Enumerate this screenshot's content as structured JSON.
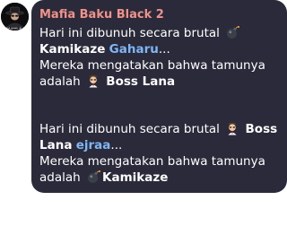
{
  "avatar": {
    "caption": "MAFIA BAKU BLACK"
  },
  "message": {
    "sender": "Mafia Baku Black 2",
    "sender_color": "#f0928a",
    "link_color": "#7fb6f5",
    "bubble_color": "#2b2a3a",
    "text_line_1": "Hari ini dibunuh secara brutal",
    "text_line_3": "Mereka mengatakan bahwa tamunya",
    "text_adalah": "adalah",
    "ellipsis": "...",
    "part1": {
      "killer_role_icon": "bomb-emoji",
      "killer_role": "Kamikaze",
      "victim_name": "Gaharu",
      "guest_role_icon": "boss-emoji",
      "guest_role": "Boss Lana"
    },
    "part2": {
      "killer_role_icon": "boss-emoji",
      "killer_role_a": "Boss",
      "killer_role_b": "Lana",
      "victim_name": "ejraa",
      "guest_role_icon": "bomb-emoji",
      "guest_role": "Kamikaze"
    }
  }
}
